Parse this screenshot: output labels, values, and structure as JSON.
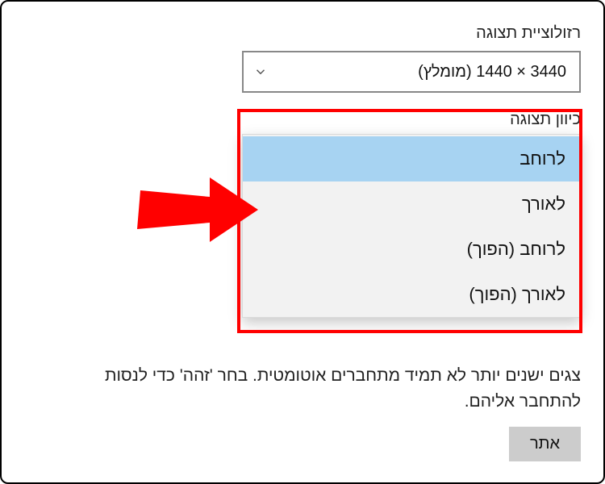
{
  "resolution": {
    "label": "רזולוציית תצוגה",
    "value": "3440 × 1440 (מומלץ)"
  },
  "orientation": {
    "label": "כיוון תצוגה",
    "options": [
      {
        "label": "לרוחב",
        "selected": true
      },
      {
        "label": "לאורך",
        "selected": false
      },
      {
        "label": "לרוחב (הפוך)",
        "selected": false
      },
      {
        "label": "לאורך (הפוך)",
        "selected": false
      }
    ]
  },
  "footer": {
    "text": "צגים ישנים יותר לא תמיד מתחברים אוטומטית. בחר 'זהה' כדי לנסות להתחבר אליהם.",
    "button": "אתר"
  },
  "icons": {
    "chevron_down": "chevron-down"
  },
  "annotation": {
    "highlight_color": "#ff0000"
  }
}
